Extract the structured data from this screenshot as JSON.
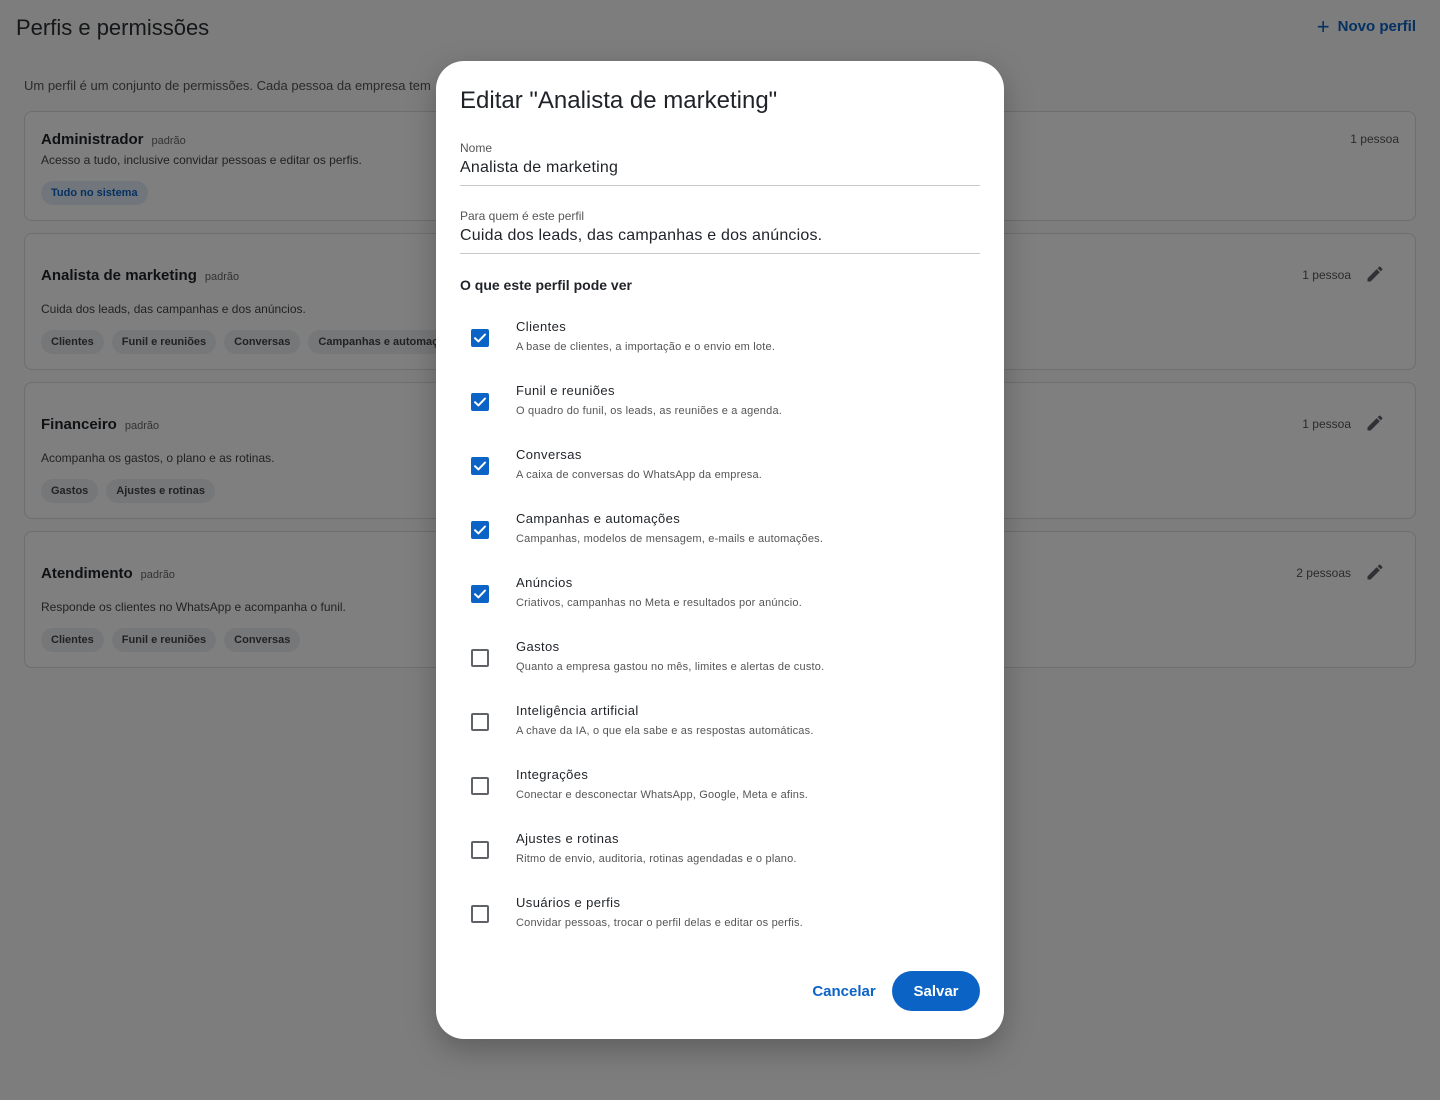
{
  "page": {
    "title": "Perfis e permissões",
    "new_profile_label": "Novo perfil",
    "intro": "Um perfil é um conjunto de permissões. Cada pessoa da empresa tem"
  },
  "cards": [
    {
      "title": "Administrador",
      "badge": "padrão",
      "description": "Acesso a tudo, inclusive convidar pessoas e editar os perfis.",
      "chips": [
        "Tudo no sistema"
      ],
      "count": "1 pessoa",
      "editable": false
    },
    {
      "title": "Analista de marketing",
      "badge": "padrão",
      "description": "Cuida dos leads, das campanhas e dos anúncios.",
      "chips": [
        "Clientes",
        "Funil e reuniões",
        "Conversas",
        "Campanhas e automações"
      ],
      "count": "1 pessoa",
      "editable": true
    },
    {
      "title": "Financeiro",
      "badge": "padrão",
      "description": "Acompanha os gastos, o plano e as rotinas.",
      "chips": [
        "Gastos",
        "Ajustes e rotinas"
      ],
      "count": "1 pessoa",
      "editable": true
    },
    {
      "title": "Atendimento",
      "badge": "padrão",
      "description": "Responde os clientes no WhatsApp e acompanha o funil.",
      "chips": [
        "Clientes",
        "Funil e reuniões",
        "Conversas"
      ],
      "count": "2 pessoas",
      "editable": true
    }
  ],
  "dialog": {
    "title": "Editar \"Analista de marketing\"",
    "name_label": "Nome",
    "name_value": "Analista de marketing",
    "audience_label": "Para quem é este perfil",
    "audience_value": "Cuida dos leads, das campanhas e dos anúncios.",
    "section_heading": "O que este perfil pode ver",
    "permissions": [
      {
        "title": "Clientes",
        "description": "A base de clientes, a importação e o envio em lote.",
        "checked": true
      },
      {
        "title": "Funil e reuniões",
        "description": "O quadro do funil, os leads, as reuniões e a agenda.",
        "checked": true
      },
      {
        "title": "Conversas",
        "description": "A caixa de conversas do WhatsApp da empresa.",
        "checked": true
      },
      {
        "title": "Campanhas e automações",
        "description": "Campanhas, modelos de mensagem, e-mails e automações.",
        "checked": true
      },
      {
        "title": "Anúncios",
        "description": "Criativos, campanhas no Meta e resultados por anúncio.",
        "checked": true
      },
      {
        "title": "Gastos",
        "description": "Quanto a empresa gastou no mês, limites e alertas de custo.",
        "checked": false
      },
      {
        "title": "Inteligência artificial",
        "description": "A chave da IA, o que ela sabe e as respostas automáticas.",
        "checked": false
      },
      {
        "title": "Integrações",
        "description": "Conectar e desconectar WhatsApp, Google, Meta e afins.",
        "checked": false
      },
      {
        "title": "Ajustes e rotinas",
        "description": "Ritmo de envio, auditoria, rotinas agendadas e o plano.",
        "checked": false
      },
      {
        "title": "Usuários e perfis",
        "description": "Convidar pessoas, trocar o perfil delas e editar os perfis.",
        "checked": false
      }
    ],
    "cancel_label": "Cancelar",
    "save_label": "Salvar"
  },
  "colors": {
    "accent": "#0b63c5",
    "scrim": "#000000"
  },
  "icons": {
    "new_profile": "plus-icon",
    "edit": "pencil-icon",
    "checked": "checkmark-icon"
  }
}
